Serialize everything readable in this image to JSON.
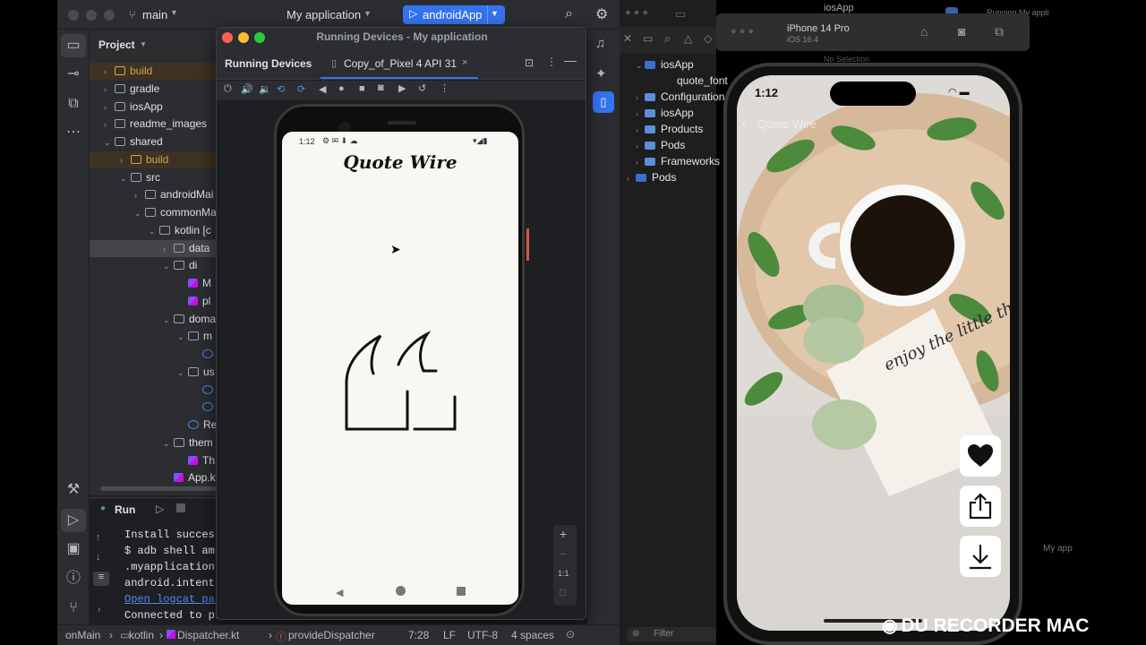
{
  "studio": {
    "branch": "main",
    "project_name": "My application",
    "run_config": "androidApp"
  },
  "project_panel": {
    "title": "Project",
    "tree": [
      {
        "label": "build",
        "icon": "folder-orange"
      },
      {
        "label": "gradle",
        "icon": "folder"
      },
      {
        "label": "iosApp",
        "icon": "folder"
      },
      {
        "label": "readme_images",
        "icon": "folder"
      },
      {
        "label": "shared",
        "icon": "module"
      },
      {
        "label": "build",
        "icon": "folder-orange"
      },
      {
        "label": "src",
        "icon": "folder"
      },
      {
        "label": "androidMai",
        "icon": "folder"
      },
      {
        "label": "commonMa",
        "icon": "folder"
      },
      {
        "label": "kotlin [c",
        "icon": "folder"
      },
      {
        "label": "data",
        "icon": "folder"
      },
      {
        "label": "di",
        "icon": "folder"
      },
      {
        "label": "M",
        "icon": "kotlin-file"
      },
      {
        "label": "pl",
        "icon": "kotlin-file"
      },
      {
        "label": "doma",
        "icon": "folder"
      },
      {
        "label": "m",
        "icon": "folder"
      },
      {
        "label": "",
        "icon": "class"
      },
      {
        "label": "us",
        "icon": "folder"
      },
      {
        "label": "",
        "icon": "class"
      },
      {
        "label": "",
        "icon": "class"
      },
      {
        "label": "Re",
        "icon": "class"
      },
      {
        "label": "them",
        "icon": "folder"
      },
      {
        "label": "Th",
        "icon": "kotlin-file"
      },
      {
        "label": "App.k",
        "icon": "kotlin-file"
      }
    ]
  },
  "run_panel": {
    "tab_label": "Run",
    "console": [
      "Install success",
      "$ adb shell am",
      " .myapplication",
      " android.intent",
      "Open logcat par",
      "Connected to pr"
    ]
  },
  "running_devices": {
    "window_title": "Running Devices - My application",
    "panel_title": "Running Devices",
    "device_tab": "Copy_of_Pixel 4 API 31",
    "zoom_label": "1:1"
  },
  "android_app": {
    "status_time": "1:12",
    "title": "Quote Wire"
  },
  "xcode": {
    "tree": [
      {
        "label": "iosApp",
        "icon": "project"
      },
      {
        "label": "quote_font",
        "icon": "file"
      },
      {
        "label": "Configuration",
        "icon": "folder"
      },
      {
        "label": "iosApp",
        "icon": "folder"
      },
      {
        "label": "Products",
        "icon": "folder"
      },
      {
        "label": "Pods",
        "icon": "folder"
      },
      {
        "label": "Frameworks",
        "icon": "folder"
      },
      {
        "label": "Pods",
        "icon": "project"
      }
    ],
    "filter_placeholder": "Filter",
    "top_label": "iosApp",
    "status_label": "Running My appli",
    "no_selection": "No Selection",
    "right_badge": "My app"
  },
  "simulator": {
    "device_name": "iPhone 14 Pro",
    "os_version": "iOS 16.4"
  },
  "ios_app": {
    "status_time": "1:12",
    "back_label": "Quote Wire",
    "note_text": "enjoy the little things"
  },
  "statusbar": {
    "breadcrumb": [
      "onMain",
      "kotlin",
      "Dispatcher.kt",
      "provideDispatcher"
    ],
    "position": "7:28",
    "line_sep": "LF",
    "encoding": "UTF-8",
    "indent": "4 spaces"
  },
  "watermark": "DU RECORDER MAC"
}
